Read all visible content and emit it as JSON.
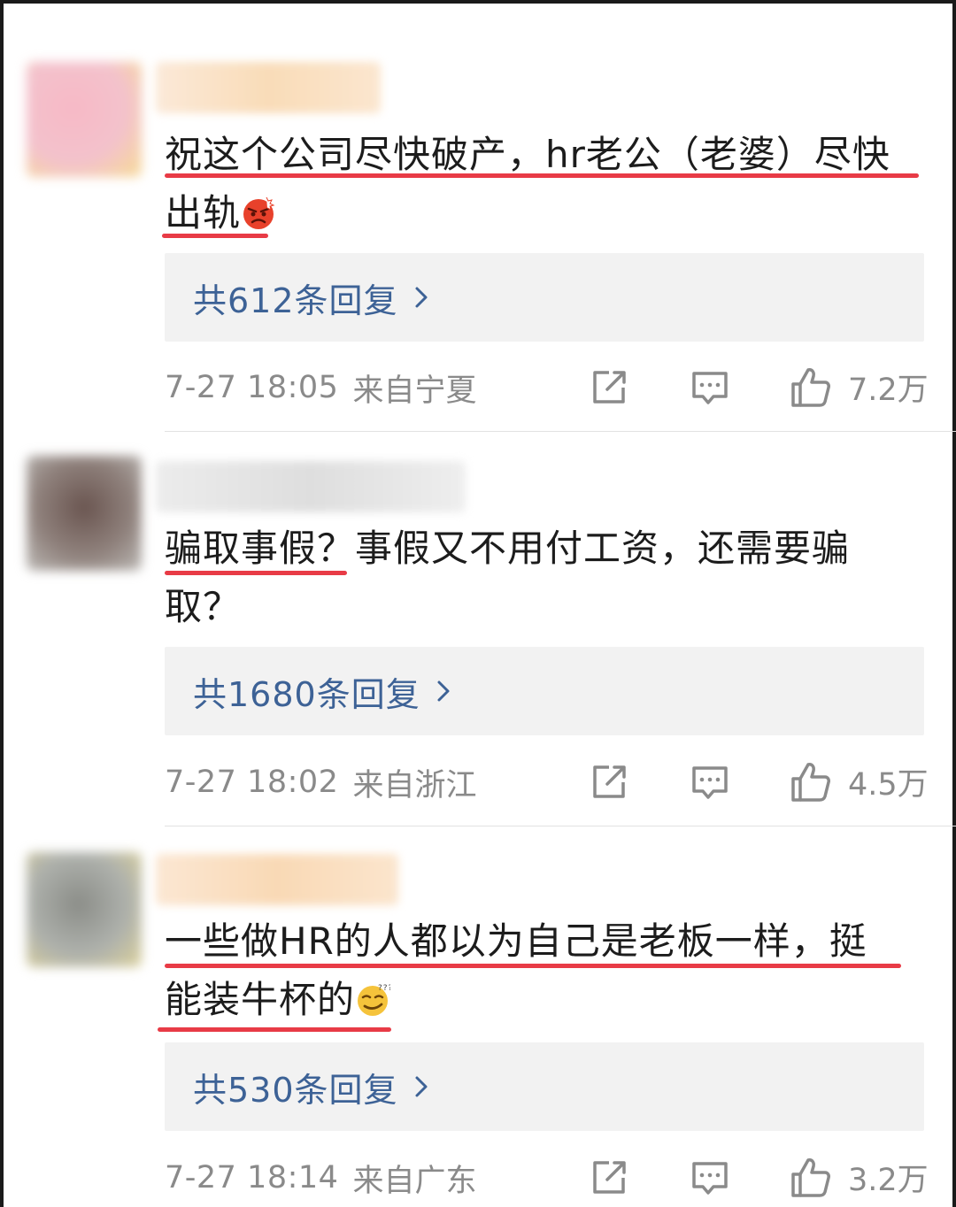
{
  "comments": [
    {
      "text_line1": "祝这个公司尽快破产，hr老公（老婆）尽快",
      "text_line2": "出轨",
      "emoji": "angry-face-emoji",
      "reply_label": "共612条回复",
      "time": "7-27 18:05",
      "location": "来自宁夏",
      "likes": "7.2万"
    },
    {
      "text_line1": "骗取事假？事假又不用付工资，还需要骗",
      "text_line2": "取？",
      "emoji": "",
      "reply_label": "共1680条回复",
      "time": "7-27 18:02",
      "location": "来自浙江",
      "likes": "4.5万"
    },
    {
      "text_line1": "一些做HR的人都以为自己是老板一样，挺",
      "text_line2": "能装牛杯的",
      "emoji": "smirk-face-emoji",
      "reply_label": "共530条回复",
      "time": "7-27 18:14",
      "location": "来自广东",
      "likes": "3.2万"
    }
  ],
  "colors": {
    "reply_link": "#3d6296",
    "underline": "#e83b46",
    "meta_gray": "#8a8a8a",
    "reply_bg": "#f2f2f2"
  },
  "icons": [
    "share-icon",
    "comment-icon",
    "like-icon",
    "chevron-right-icon"
  ]
}
